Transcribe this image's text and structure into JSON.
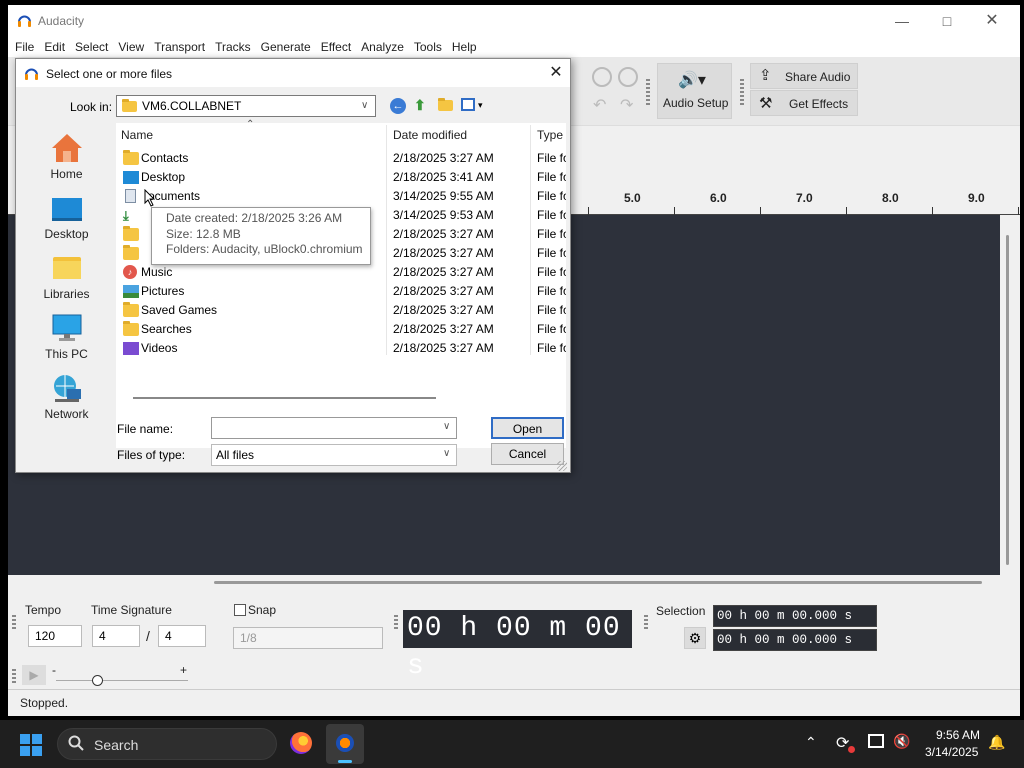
{
  "app": {
    "title": "Audacity",
    "menu": [
      "File",
      "Edit",
      "Select",
      "View",
      "Transport",
      "Tracks",
      "Generate",
      "Effect",
      "Analyze",
      "Tools",
      "Help"
    ],
    "toolbar": {
      "audio_setup": "Audio Setup",
      "share_audio": "Share Audio",
      "get_effects": "Get Effects"
    },
    "ruler": [
      "5.0",
      "6.0",
      "7.0",
      "8.0",
      "9.0"
    ],
    "bottom": {
      "tempo_label": "Tempo",
      "tempo_value": "120",
      "time_sig_label": "Time Signature",
      "time_sig_num": "4",
      "time_sig_slash": "/",
      "time_sig_den": "4",
      "snap_label": "Snap",
      "snap_value": "1/8",
      "time_display": "00 h 00 m 00 s",
      "selection_label": "Selection",
      "selection_start": "00 h 00 m 00.000 s",
      "selection_end": "00 h 00 m 00.000 s",
      "slider_minus": "-",
      "slider_plus": "+"
    },
    "status": "Stopped."
  },
  "dialog": {
    "title": "Select one or more files",
    "look_in_label": "Look in:",
    "look_in_value": "VM6.COLLABNET",
    "places": [
      "Home",
      "Desktop",
      "Libraries",
      "This PC",
      "Network"
    ],
    "columns": {
      "name": "Name",
      "date": "Date modified",
      "type": "Type"
    },
    "rows": [
      {
        "name": "Contacts",
        "date": "2/18/2025 3:27 AM",
        "type": "File fo"
      },
      {
        "name": "Desktop",
        "date": "2/18/2025 3:41 AM",
        "type": "File fo"
      },
      {
        "name": "ocuments",
        "date": "3/14/2025 9:55 AM",
        "type": "File fo"
      },
      {
        "name": "",
        "date": "3/14/2025 9:53 AM",
        "type": "File fo"
      },
      {
        "name": "",
        "date": "2/18/2025 3:27 AM",
        "type": "File fo"
      },
      {
        "name": "",
        "date": "2/18/2025 3:27 AM",
        "type": "File fo"
      },
      {
        "name": "Music",
        "date": "2/18/2025 3:27 AM",
        "type": "File fo"
      },
      {
        "name": "Pictures",
        "date": "2/18/2025 3:27 AM",
        "type": "File fo"
      },
      {
        "name": "Saved Games",
        "date": "2/18/2025 3:27 AM",
        "type": "File fo"
      },
      {
        "name": "Searches",
        "date": "2/18/2025 3:27 AM",
        "type": "File fo"
      },
      {
        "name": "Videos",
        "date": "2/18/2025 3:27 AM",
        "type": "File fo"
      }
    ],
    "tooltip": {
      "line1": "Date created: 2/18/2025 3:26 AM",
      "line2": "Size: 12.8 MB",
      "line3": "Folders: Audacity, uBlock0.chromium"
    },
    "file_name_label": "File name:",
    "file_name_value": "",
    "files_of_type_label": "Files of type:",
    "files_of_type_value": "All files",
    "open_button": "Open",
    "cancel_button": "Cancel"
  },
  "taskbar": {
    "search_placeholder": "Search",
    "time": "9:56 AM",
    "date": "3/14/2025"
  }
}
